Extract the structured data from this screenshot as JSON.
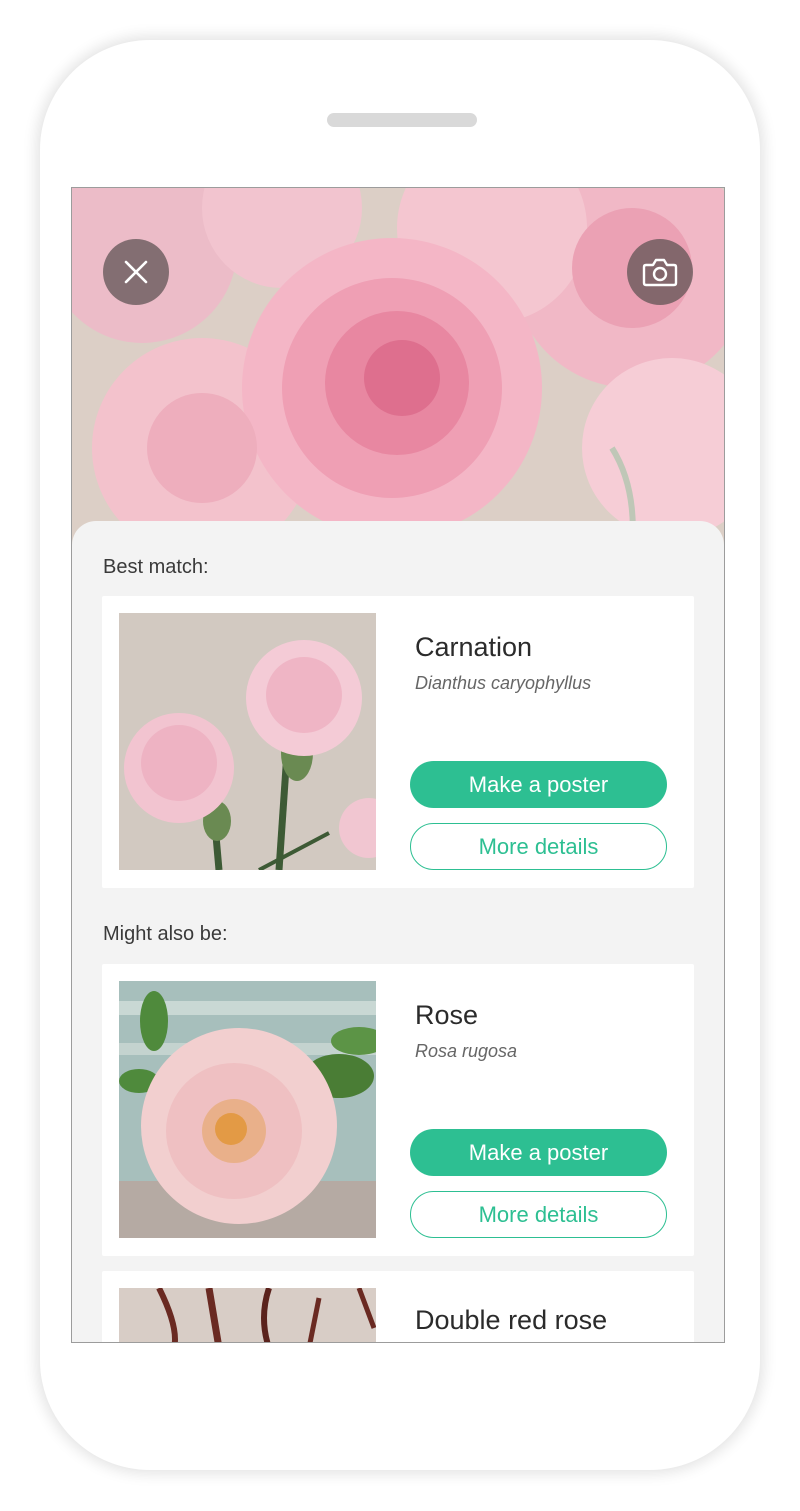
{
  "header": {
    "close_icon": "close-icon",
    "camera_icon": "camera-icon"
  },
  "best_match": {
    "label": "Best match:",
    "card": {
      "name": "Carnation",
      "latin": "Dianthus caryophyllus",
      "poster_button": "Make a poster",
      "details_button": "More details"
    }
  },
  "might_also_be": {
    "label": "Might also be:",
    "cards": [
      {
        "name": "Rose",
        "latin": "Rosa rugosa",
        "poster_button": "Make a poster",
        "details_button": "More details"
      },
      {
        "name": "Double red rose"
      }
    ]
  },
  "colors": {
    "accent": "#2dbf92",
    "background": "#f3f3f3"
  }
}
